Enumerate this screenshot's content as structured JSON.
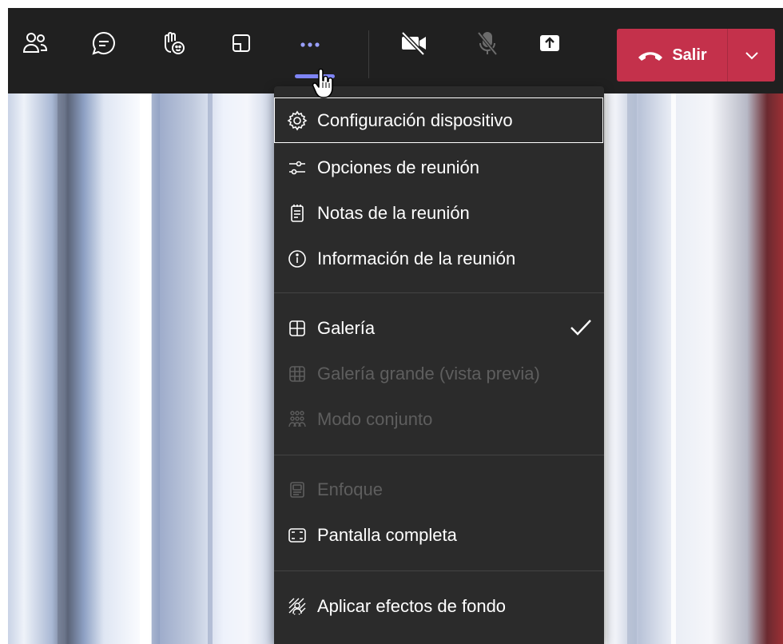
{
  "toolbar": {
    "buttons": [
      {
        "name": "participants-icon"
      },
      {
        "name": "chat-icon"
      },
      {
        "name": "raise-hand-icon"
      },
      {
        "name": "rooms-icon"
      },
      {
        "name": "more-actions-icon"
      },
      {
        "name": "camera-off-icon"
      },
      {
        "name": "mic-off-icon"
      },
      {
        "name": "share-tray-icon"
      }
    ],
    "leave_label": "Salir",
    "leave_color": "#c4314b",
    "accent_color": "#7f85f5"
  },
  "menu": {
    "items": [
      {
        "label": "Configuración dispositivo",
        "icon": "gear-icon",
        "state": "focused"
      },
      {
        "label": "Opciones de reunión",
        "icon": "sliders-icon"
      },
      {
        "label": "Notas de la reunión",
        "icon": "notes-icon"
      },
      {
        "label": "Información de la reunión",
        "icon": "info-icon"
      },
      {
        "label": "Galería",
        "icon": "gallery-icon",
        "checked": true
      },
      {
        "label": "Galería grande (vista previa)",
        "icon": "large-gallery-icon",
        "disabled": true
      },
      {
        "label": "Modo conjunto",
        "icon": "together-mode-icon",
        "disabled": true
      },
      {
        "label": "Enfoque",
        "icon": "focus-icon",
        "disabled": true
      },
      {
        "label": "Pantalla completa",
        "icon": "fullscreen-icon"
      },
      {
        "label": "Aplicar efectos de fondo",
        "icon": "background-effects-icon"
      }
    ]
  }
}
